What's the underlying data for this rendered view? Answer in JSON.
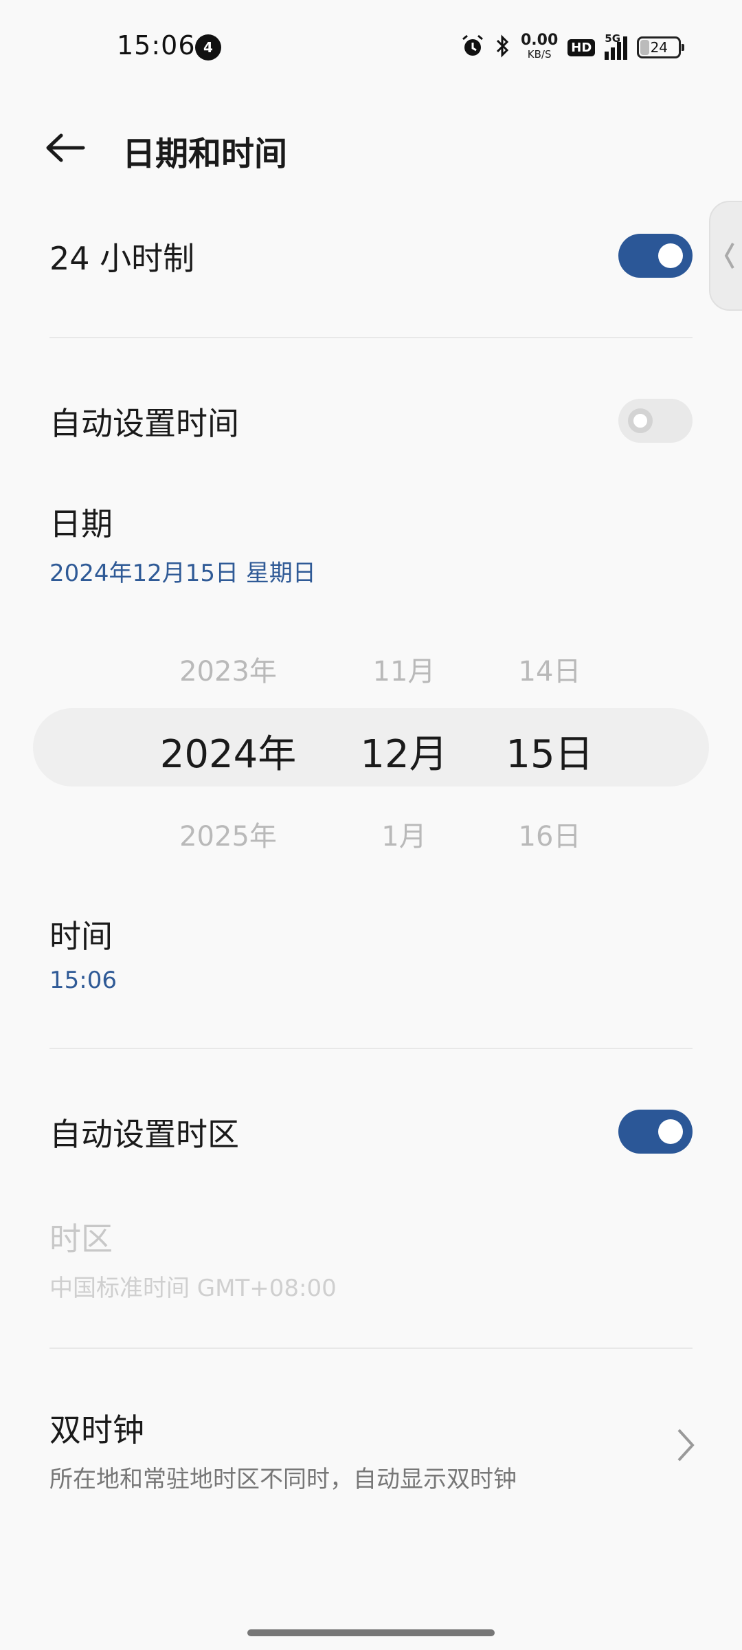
{
  "status_bar": {
    "time": "15:06",
    "notification_count": "4",
    "net_speed_value": "0.00",
    "net_speed_unit": "KB/S",
    "hd_label": "HD",
    "signal_label": "5G",
    "battery_level": "24",
    "battery_fraction": 0.24
  },
  "header": {
    "title": "日期和时间"
  },
  "settings": {
    "hour24": {
      "label": "24 小时制",
      "enabled": true
    },
    "auto_time": {
      "label": "自动设置时间",
      "enabled": false
    },
    "date": {
      "label": "日期",
      "value": "2024年12月15日 星期日"
    },
    "time": {
      "label": "时间",
      "value": "15:06"
    },
    "auto_timezone": {
      "label": "自动设置时区",
      "enabled": true
    },
    "timezone": {
      "label": "时区",
      "value": "中国标准时间 GMT+08:00"
    },
    "dual_clock": {
      "label": "双时钟",
      "description": "所在地和常驻地时区不同时，自动显示双时钟"
    }
  },
  "date_picker": {
    "year": {
      "prev": "2023年",
      "selected": "2024年",
      "next": "2025年"
    },
    "month": {
      "prev": "11月",
      "selected": "12月",
      "next": "1月"
    },
    "day": {
      "prev": "14日",
      "selected": "15日",
      "next": "16日"
    }
  },
  "colors": {
    "accent": "#2b5797",
    "background": "#f9f9f9"
  }
}
